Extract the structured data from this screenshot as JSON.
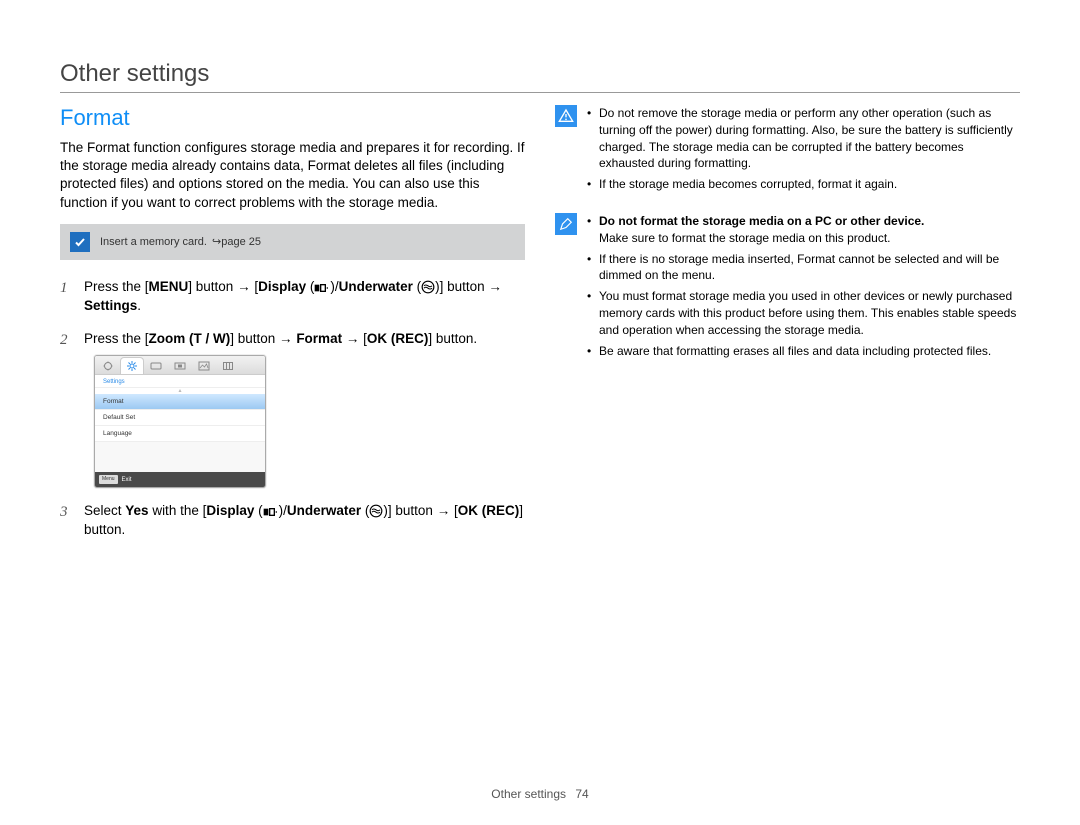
{
  "page_title": "Other settings",
  "section_title": "Format",
  "intro": "The Format function configures storage media and prepares it for recording. If the storage media already contains data, Format deletes all files (including protected files) and options stored on the media. You can also use this function if you want to correct problems with the storage media.",
  "memory_note": {
    "text": "Insert a memory card.",
    "page_ref": "page 25"
  },
  "steps": {
    "s1_prefix": "Press the [",
    "s1_menu": "MENU",
    "s1_mid1": "] button → [",
    "s1_display": "Display",
    "s1_mid2": " (",
    "s1_mid3": ")/",
    "s1_underwater": "Underwater",
    "s1_mid4": " (",
    "s1_mid5": ")] button → ",
    "s1_settings": "Settings",
    "s1_end": ".",
    "s2_prefix": "Press the [",
    "s2_zoom": "Zoom (T / W)",
    "s2_mid1": "] button → ",
    "s2_format": "Format",
    "s2_mid2": " → [",
    "s2_okrec": "OK (REC)",
    "s2_end": "] button.",
    "s3_prefix": "Select ",
    "s3_yes": "Yes",
    "s3_mid1": " with the [",
    "s3_display": "Display",
    "s3_mid2": " (",
    "s3_mid3": ")/",
    "s3_underwater": "Underwater",
    "s3_mid4": " (",
    "s3_mid5": ")] button → [",
    "s3_okrec": "OK (REC)",
    "s3_end": "] button."
  },
  "device_screen": {
    "header": "Settings",
    "rows": [
      "Format",
      "Default Set",
      "Language"
    ],
    "footer_button": "Menu",
    "footer_text": "Exit"
  },
  "warnings": [
    "Do not remove the storage media or perform any other operation (such as turning off the power) during formatting. Also, be sure the battery is sufficiently charged. The storage media can be corrupted if the battery becomes exhausted during formatting.",
    "If the storage media becomes corrupted, format it again."
  ],
  "notes2": {
    "lead_bold": "Do not format the storage media on a PC or other device.",
    "lead_rest": "Make sure to format the storage media on this product.",
    "items": [
      "If there is no storage media inserted, Format cannot be selected and will be dimmed on the menu.",
      "You must format storage media you used in other devices or newly purchased memory cards with this product before using them. This enables stable speeds and operation when accessing the storage media.",
      "Be aware that formatting erases all files and data including protected files."
    ]
  },
  "footer": {
    "label": "Other settings",
    "page": "74"
  },
  "icons": {
    "display_icon": "display-toggle-icon",
    "underwater_icon": "underwater-icon"
  }
}
